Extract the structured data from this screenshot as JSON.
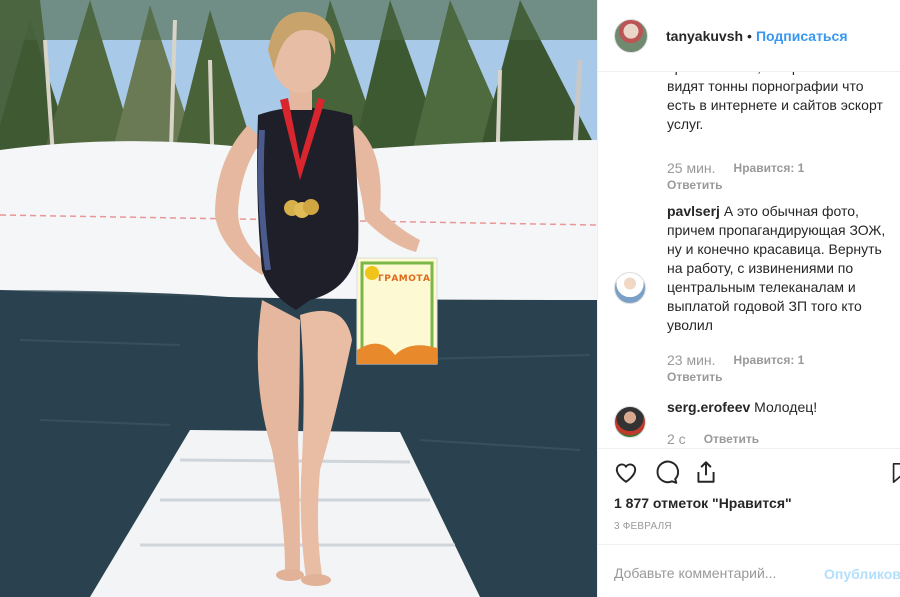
{
  "post": {
    "username": "tanyakuvsh",
    "follow_label": "Подписаться",
    "separator": "•"
  },
  "comments": [
    {
      "username": "",
      "text": "правильность, но при этом не видят тонны порнографии что есть в интернете и сайтов эскорт услуг.",
      "time": "25 мин.",
      "likes": "Нравится: 1",
      "reply": "Ответить"
    },
    {
      "username": "pavlserj",
      "text": "А это обычная фото, причем пропагандирующая ЗОЖ, ну и конечно красавица. Вернуть на работу, с извинениями по центральным телеканалам и выплатой годовой ЗП того кто уволил",
      "time": "23 мин.",
      "likes": "Нравится: 1",
      "reply": "Ответить"
    },
    {
      "username": "serg.erofeev",
      "text": "Молодец!",
      "time": "2 с",
      "reply": "Ответить"
    }
  ],
  "actions": {
    "likes_count": "1 877 отметок \"Нравится\"",
    "date": "3 февраля",
    "comment_placeholder": "Добавьте комментарий...",
    "publish_label": "Опубликовать"
  },
  "photo": {
    "certificate_title": "ГРАМОТА"
  },
  "colors": {
    "link_blue": "#3897f0",
    "muted": "#999999",
    "text": "#262626",
    "publish_disabled": "#b2dffc"
  }
}
